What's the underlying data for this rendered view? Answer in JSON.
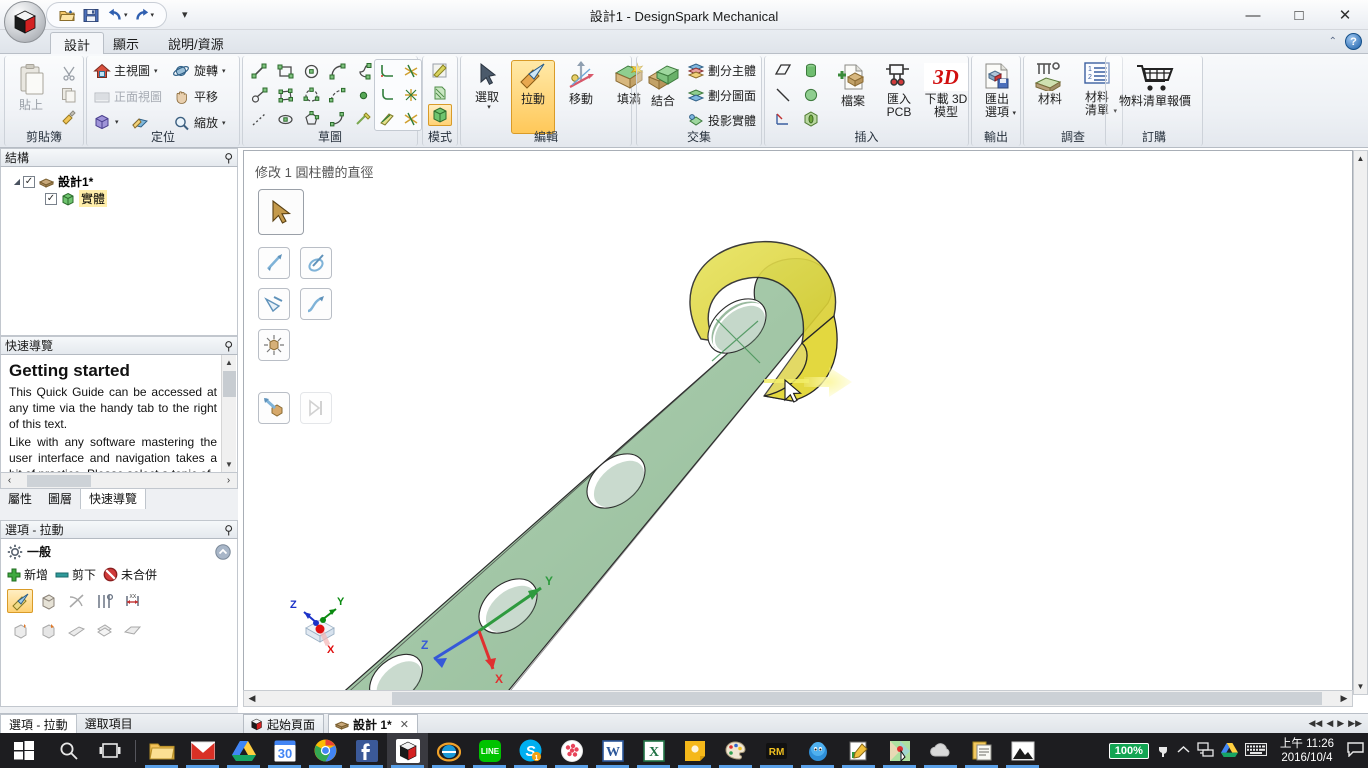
{
  "window": {
    "title": "設計1 - DesignSpark Mechanical",
    "minimize": "—",
    "maximize": "□",
    "close": "✕"
  },
  "quick_access": {
    "open": "open-folder-icon",
    "save": "save-icon",
    "undo": "undo-icon",
    "redo": "redo-icon",
    "more": "▾"
  },
  "ribbon_tabs": [
    {
      "label": "設計",
      "active": true
    },
    {
      "label": "顯示",
      "active": false
    },
    {
      "label": "說明/資源",
      "active": false
    }
  ],
  "ribbon": {
    "clipboard": {
      "group_label": "剪貼簿",
      "paste_label": "貼上",
      "cut_label": "剪下",
      "copy_label": "複製",
      "format_label": "複製格式"
    },
    "orient": {
      "group_label": "定位",
      "items": [
        {
          "label": "主視圖",
          "caret": true,
          "disabled": false
        },
        {
          "label": "旋轉",
          "caret": true,
          "disabled": false
        },
        {
          "label": "正面視圖",
          "caret": false,
          "disabled": true
        },
        {
          "label": "平移",
          "caret": false,
          "disabled": false
        },
        {
          "label": "",
          "caret": true,
          "disabled": false
        },
        {
          "label": "縮放",
          "caret": true,
          "disabled": false
        }
      ]
    },
    "sketch": {
      "group_label": "草圖"
    },
    "mode": {
      "group_label": "模式"
    },
    "edit": {
      "group_label": "編輯",
      "items": [
        {
          "label": "選取",
          "caret": true,
          "selected": false
        },
        {
          "label": "拉動",
          "caret": false,
          "selected": true
        },
        {
          "label": "移動",
          "caret": false,
          "selected": false
        },
        {
          "label": "填滿",
          "caret": false,
          "selected": false
        }
      ]
    },
    "intersect": {
      "group_label": "交集",
      "combine_label": "結合",
      "items": [
        "劃分主體",
        "劃分圖面",
        "投影實體"
      ]
    },
    "insert": {
      "group_label": "插入",
      "file_label": "檔案",
      "pcb_label": "匯入\nPCB",
      "model3d_label": "下載 3D\n模型",
      "model3d_badge": "3D"
    },
    "output": {
      "group_label": "輸出",
      "export_label": "匯出\n選項"
    },
    "survey": {
      "group_label": "調查",
      "material_label": "材料",
      "bom_label": "材料\n清單"
    },
    "order": {
      "group_label": "訂購",
      "bom_quote_label": "物料清單報價"
    }
  },
  "structure_panel": {
    "title": "結構",
    "pin": "⚲",
    "nodes": [
      {
        "label": "設計1*",
        "icon": "design-icon",
        "checked": true,
        "bold": true,
        "highlighted": false,
        "indent": 0
      },
      {
        "label": "實體",
        "icon": "solid-icon",
        "checked": true,
        "bold": false,
        "highlighted": true,
        "indent": 1
      }
    ]
  },
  "quicknav_panel": {
    "title": "快速導覽",
    "pin": "⚲",
    "heading": "Getting started",
    "paragraphs": [
      "This Quick Guide can be accessed at any time via the handy tab to the right of this text.",
      "Like with any software mastering the user interface and navigation takes a bit of practice. Please select a topic of"
    ],
    "tabs": [
      {
        "label": "屬性",
        "active": false
      },
      {
        "label": "圖層",
        "active": false
      },
      {
        "label": "快速導覽",
        "active": true
      }
    ],
    "prev": "‹",
    "next": "›"
  },
  "options_panel": {
    "title": "選項 - 拉動",
    "pin": "⚲",
    "section_label": "一般",
    "collapse": "⌃",
    "actions": [
      {
        "label": "新增",
        "icon": "plus-icon"
      },
      {
        "label": "剪下",
        "icon": "minus-icon"
      },
      {
        "label": "未合併",
        "icon": "no-merge-icon"
      }
    ],
    "tool_icons_row1": [
      "pull-directed-icon",
      "pull-face-icon",
      "pull-revolve-icon",
      "pull-sweep-icon",
      "pull-scale-icon"
    ],
    "tool_icons_row2": [
      "pull-round-icon",
      "pull-chamfer-icon",
      "pull-draft-icon",
      "pull-offset-icon",
      "pull-shell-icon"
    ]
  },
  "status_tabs": [
    {
      "label": "選項 - 拉動",
      "active": true
    },
    {
      "label": "選取項目",
      "active": false
    }
  ],
  "viewport": {
    "hint": "修改 1 圓柱體的直徑",
    "tools": [
      {
        "name": "select-arrow-tool",
        "icon": "cursor-icon",
        "size": "big",
        "disabled": false
      },
      {
        "name": "pull-direction-tool",
        "icon": "arrow-up-icon",
        "size": "sm",
        "disabled": false
      },
      {
        "name": "pull-revolve-tool",
        "icon": "revolve-icon",
        "size": "sm",
        "disabled": false
      },
      {
        "name": "pull-sweep-tool",
        "icon": "sweep-icon",
        "size": "sm",
        "disabled": false
      },
      {
        "name": "pull-curve-tool",
        "icon": "curve-arrow-icon",
        "size": "sm",
        "disabled": false
      },
      {
        "name": "pull-scale-tool",
        "icon": "scale-box-icon",
        "size": "sm",
        "disabled": false
      },
      {
        "name": "pull-apply-tool",
        "icon": "apply-icon",
        "size": "sm",
        "disabled": false
      },
      {
        "name": "pull-next-tool",
        "icon": "step-next-icon",
        "size": "sm",
        "disabled": true
      }
    ],
    "axis_labels": {
      "x": "X",
      "y": "Y",
      "z": "Z"
    },
    "colors": {
      "body": "#a8c9ac",
      "highlight": "#ddd24a",
      "arrow": "#f7f39c"
    }
  },
  "doc_tabs": [
    {
      "label": "起始頁面",
      "active": false,
      "closable": false
    },
    {
      "label": "設計 1*",
      "active": true,
      "closable": true,
      "close": "✕"
    }
  ],
  "taskbar": {
    "start": "start-icon",
    "search": "search-icon",
    "taskview": "task-view-icon",
    "items": [
      "file-explorer-icon",
      "gmail-icon",
      "google-drive-icon",
      "google-calendar-icon",
      "chrome-icon",
      "facebook-icon",
      "designspark-icon",
      "internet-explorer-icon",
      "line-icon",
      "skype-icon",
      "evernote-icon",
      "word-icon",
      "excel-icon",
      "sticky-notes-icon",
      "paint-icon",
      "rm-icon",
      "blender-icon",
      "notepad-editor-icon",
      "photo-editor-icon",
      "cloud-icon",
      "clipboard-icon",
      "photos-icon"
    ],
    "tray": {
      "battery": "100%",
      "plug": "power-icon",
      "chevron": "show-hidden-icons-icon",
      "network": "network-icon",
      "drive": "google-drive-tray-icon",
      "keyboard": "keyboard-icon",
      "time": "上午 11:26",
      "date": "2016/10/4",
      "notification": "action-center-icon"
    }
  }
}
